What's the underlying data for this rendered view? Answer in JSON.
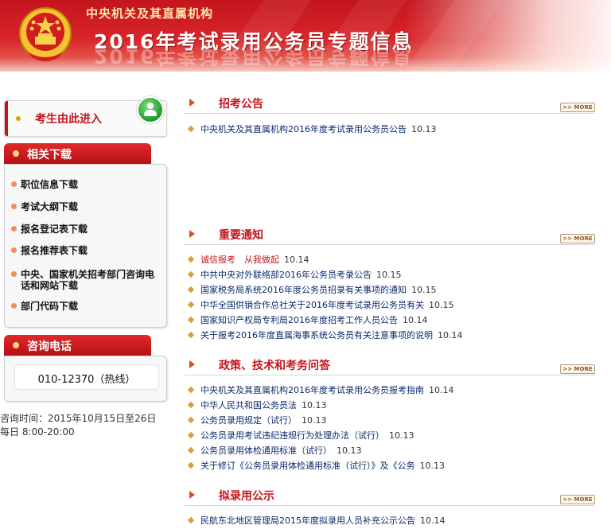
{
  "banner": {
    "subtitle": "中央机关及其直属机构",
    "title": "2016年考试录用公务员专题信息"
  },
  "colors": {
    "brand_red": "#c4151d",
    "link_blue": "#0b2a6b",
    "accent_orange": "#d6501d"
  },
  "sidebar": {
    "entry_label": "考生由此进入",
    "downloads_title": "相关下载",
    "downloads": [
      "职位信息下载",
      "考试大纲下载",
      "报名登记表下载",
      "报名推荐表下载",
      "中央、国家机关招考部门咨询电话和网站下载",
      "部门代码下载"
    ],
    "phone_title": "咨询电话",
    "phone_number": "010-12370（热线）",
    "hours_line1": "咨询时间：2015年10月15日至26日",
    "hours_line2": "每日 8:00-20:00"
  },
  "more_label": ">> MORE",
  "sections": [
    {
      "title": "招考公告",
      "items": [
        {
          "text": "中央机关及其直属机构2016年度考试录用公务员公告",
          "date": "10.13"
        }
      ]
    },
    {
      "title": "重要通知",
      "items": [
        {
          "text": "诚信报考　从我做起",
          "date": "10.14"
        },
        {
          "text": "中共中央对外联络部2016年公务员考录公告",
          "date": "10.15"
        },
        {
          "text": "国家税务局系统2016年度公务员招录有关事项的通知",
          "date": "10.15"
        },
        {
          "text": "中华全国供销合作总社关于2016年度考试录用公务员有关",
          "date": "10.15"
        },
        {
          "text": "国家知识产权局专利局2016年度招考工作人员公告",
          "date": "10.14"
        },
        {
          "text": "关于报考2016年度直属海事系统公务员有关注意事项的说明",
          "date": "10.14"
        }
      ]
    },
    {
      "title": "政策、技术和考务问答",
      "items": [
        {
          "text": "中央机关及其直属机构2016年度考试录用公务员报考指南",
          "date": "10.14"
        },
        {
          "text": "中华人民共和国公务员法",
          "date": "10.13"
        },
        {
          "text": "公务员录用规定（试行）",
          "date": "10.13"
        },
        {
          "text": "公务员录用考试违纪违规行为处理办法（试行）",
          "date": "10.13"
        },
        {
          "text": "公务员录用体检通用标准（试行）",
          "date": "10.13"
        },
        {
          "text": "关于修订《公务员录用体检通用标准（试行）》及《公务",
          "date": "10.13"
        }
      ]
    },
    {
      "title": "拟录用公示",
      "items": [
        {
          "text": "民航东北地区管理局2015年度拟录用人员补充公示公告",
          "date": "10.14"
        }
      ]
    }
  ]
}
